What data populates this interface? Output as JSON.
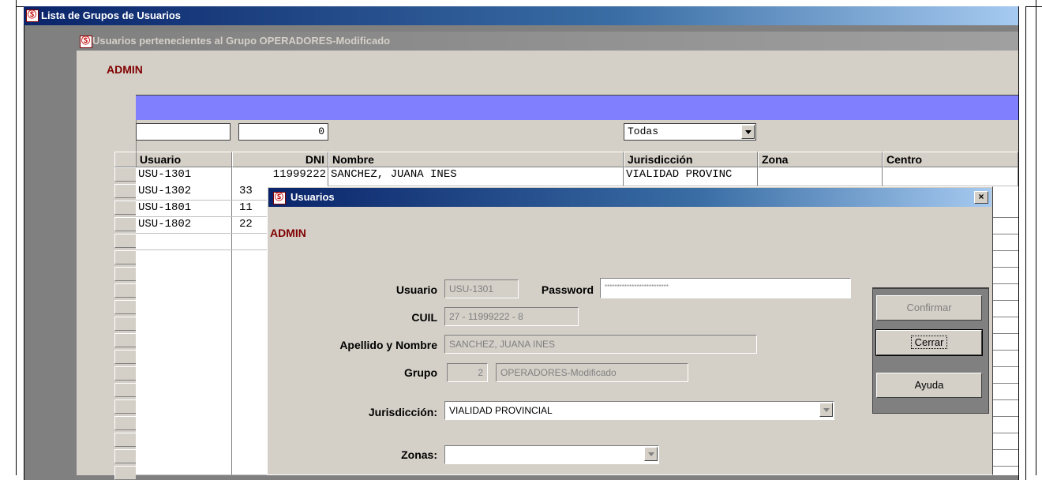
{
  "outer_window": {
    "title": "Lista de Grupos de Usuarios"
  },
  "inner_window": {
    "title": "Usuarios pertenecientes al Grupo OPERADORES-Modificado",
    "user": "ADMIN"
  },
  "grid": {
    "filters": {
      "usuario": "",
      "dni": "0",
      "jurisdiccion": "Todas"
    },
    "columns": [
      "Usuario",
      "DNI",
      "Nombre",
      "Jurisdicción",
      "Zona",
      "Centro"
    ],
    "rows": [
      {
        "usuario": "USU-1301",
        "dni": "11999222",
        "nombre": "SANCHEZ, JUANA INES",
        "jurisdiccion": "VIALIDAD PROVINC"
      },
      {
        "usuario": "USU-1302",
        "dni": "33"
      },
      {
        "usuario": "USU-1801",
        "dni": "11"
      },
      {
        "usuario": "USU-1802",
        "dni": "22"
      }
    ]
  },
  "dialog": {
    "title": "Usuarios",
    "user": "ADMIN",
    "labels": {
      "usuario": "Usuario",
      "password": "Password",
      "cuil": "CUIL",
      "apellido": "Apellido y Nombre",
      "grupo": "Grupo",
      "jurisdiccion": "Jurisdicción:",
      "zonas": "Zonas:"
    },
    "values": {
      "usuario": "USU-1301",
      "password": "**************************",
      "cuil": "27 - 11999222 - 8",
      "apellido": "SANCHEZ, JUANA INES",
      "grupo_num": "2",
      "grupo_nombre": "OPERADORES-Modificado",
      "jurisdiccion": "VIALIDAD PROVINCIAL",
      "zonas": ""
    },
    "buttons": {
      "confirmar": "Confirmar",
      "cerrar": "Cerrar",
      "ayuda": "Ayuda"
    },
    "close_glyph": "×"
  }
}
